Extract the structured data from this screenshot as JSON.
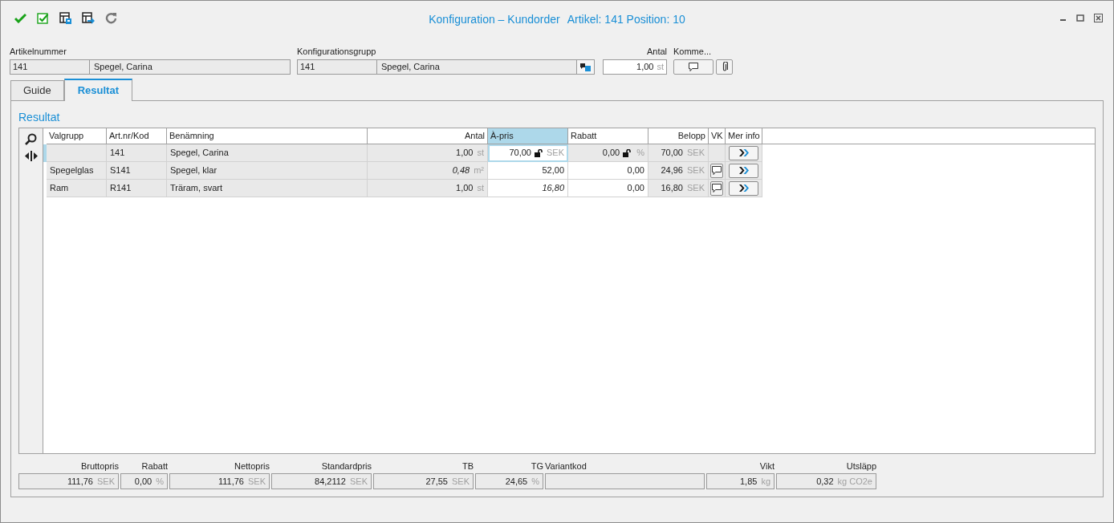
{
  "window": {
    "title": "Konfiguration – Kundorder",
    "detail": "Artikel: 141 Position: 10"
  },
  "fields": {
    "article": {
      "label": "Artikelnummer",
      "code": "141",
      "name": "Spegel, Carina"
    },
    "config_group": {
      "label": "Konfigurationsgrupp",
      "code": "141",
      "name": "Spegel, Carina"
    },
    "quantity": {
      "label": "Antal",
      "value": "1,00",
      "unit": "st"
    },
    "comment": {
      "label": "Komme..."
    }
  },
  "tabs": [
    {
      "label": "Guide",
      "selected": false
    },
    {
      "label": "Resultat",
      "selected": true
    }
  ],
  "section_title": "Resultat",
  "table": {
    "columns": [
      {
        "label": "Valgrupp",
        "selected": false
      },
      {
        "label": "Art.nr/Kod",
        "selected": false
      },
      {
        "label": "Benämning",
        "selected": false
      },
      {
        "label": "Antal",
        "selected": false
      },
      {
        "label": "À-pris",
        "selected": true
      },
      {
        "label": "Rabatt",
        "selected": false
      },
      {
        "label": "Belopp",
        "selected": false
      },
      {
        "label": "VK",
        "selected": false
      },
      {
        "label": "Mer info",
        "selected": false
      }
    ],
    "rows": [
      {
        "selected": true,
        "group": "",
        "code": "141",
        "name": "Spegel, Carina",
        "quantity": {
          "value": "1,00",
          "unit": "st",
          "italic": false
        },
        "price": {
          "value": "70,00",
          "unit": "SEK",
          "lock": true,
          "italic": false,
          "editable": true,
          "focused": true
        },
        "discount": {
          "value": "0,00",
          "unit": "%",
          "lock": true,
          "editable": false
        },
        "amount": {
          "value": "70,00",
          "unit": "SEK"
        },
        "comment": false
      },
      {
        "selected": false,
        "group": "Spegelglas",
        "code": "S141",
        "name": "Spegel, klar",
        "quantity": {
          "value": "0,48",
          "unit": "m²",
          "italic": true
        },
        "price": {
          "value": "52,00",
          "lock": false,
          "italic": false,
          "editable": true,
          "focused": false
        },
        "discount": {
          "value": "0,00",
          "lock": false,
          "editable": true
        },
        "amount": {
          "value": "24,96",
          "unit": "SEK"
        },
        "comment": true
      },
      {
        "selected": false,
        "group": "Ram",
        "code": "R141",
        "name": "Träram, svart",
        "quantity": {
          "value": "1,00",
          "unit": "st",
          "italic": false
        },
        "price": {
          "value": "16,80",
          "lock": false,
          "italic": true,
          "editable": true,
          "focused": false
        },
        "discount": {
          "value": "0,00",
          "lock": false,
          "editable": true
        },
        "amount": {
          "value": "16,80",
          "unit": "SEK"
        },
        "comment": true
      }
    ]
  },
  "summary": [
    {
      "label": "Bruttopris",
      "value": "111,76",
      "unit": "SEK"
    },
    {
      "label": "Rabatt",
      "value": "0,00",
      "unit": "%"
    },
    {
      "label": "Nettopris",
      "value": "111,76",
      "unit": "SEK"
    },
    {
      "label": "Standardpris",
      "value": "84,2112",
      "unit": "SEK"
    },
    {
      "label": "TB",
      "value": "27,55",
      "unit": "SEK"
    },
    {
      "label": "TG",
      "value": "24,65",
      "unit": "%"
    },
    {
      "label": "Variantkod"
    },
    {
      "label": "Vikt",
      "value": "1,85",
      "unit": "kg"
    },
    {
      "label": "Utsläpp",
      "value": "0,32",
      "unit": "kg CO2e"
    }
  ]
}
